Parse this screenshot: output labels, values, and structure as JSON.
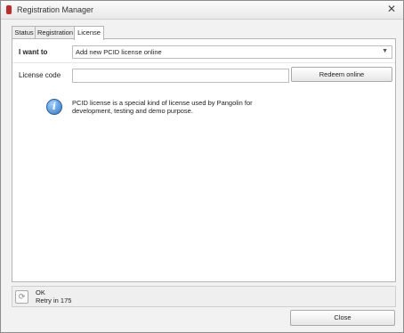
{
  "window": {
    "title": "Registration Manager",
    "close_symbol": "✕"
  },
  "tabs": [
    {
      "label": "Status",
      "active": false
    },
    {
      "label": "Registration",
      "active": false
    },
    {
      "label": "License",
      "active": true
    }
  ],
  "form": {
    "i_want_to_label": "I want to",
    "dropdown_value": "Add new PCID license online",
    "license_code_label": "License code",
    "license_code_value": "",
    "redeem_button": "Redeem online"
  },
  "info": {
    "text": "PCID license is a special kind of license used by Pangolin for development, testing and demo purpose."
  },
  "status": {
    "line1": "OK",
    "line2": "Retry in 175"
  },
  "footer": {
    "close_button": "Close"
  },
  "colors": {
    "active_tab_accent": "#ffffff",
    "info_blue": "#2f76c9"
  },
  "icons": [
    "app-icon",
    "close-icon",
    "dropdown-arrow-icon",
    "info-icon",
    "status-refresh-icon"
  ]
}
